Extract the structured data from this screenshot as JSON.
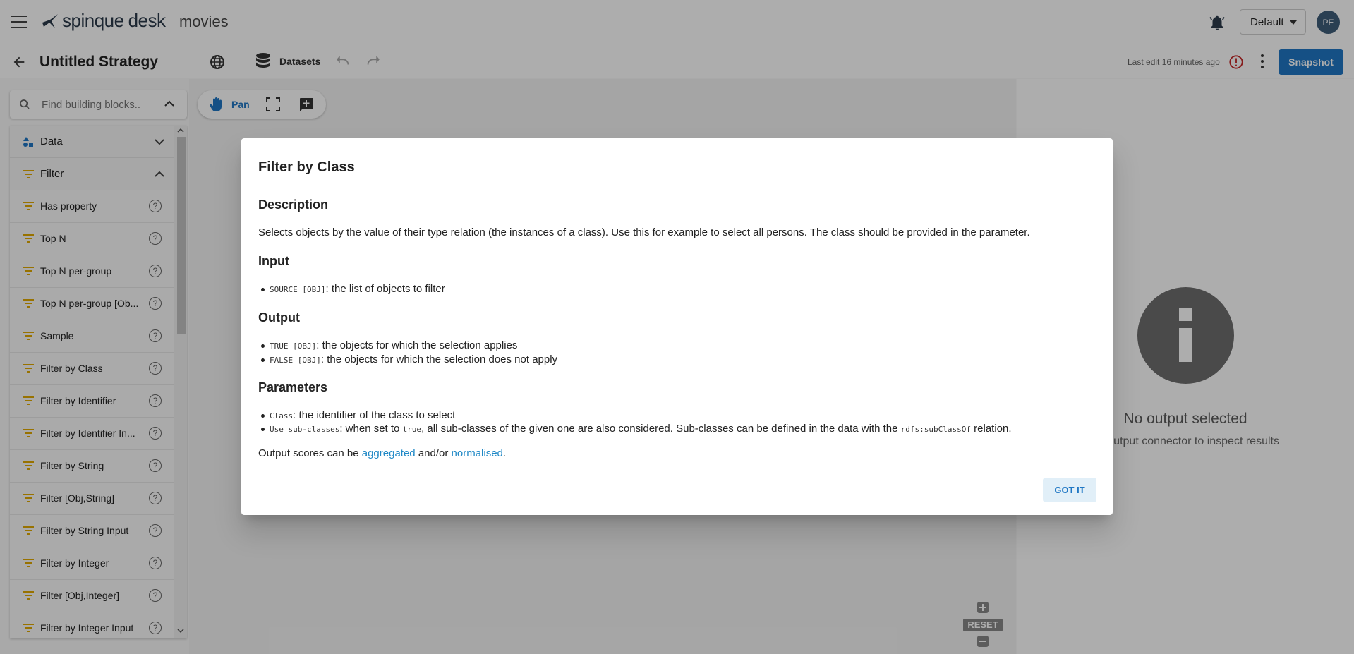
{
  "app": {
    "logo_text": "spinque",
    "logo_suffix": "desk",
    "project": "movies",
    "workspace": "Default",
    "user_initials": "PE"
  },
  "toolbar": {
    "title": "Untitled Strategy",
    "datasets_label": "Datasets",
    "last_edit": "Last edit 16 minutes ago",
    "snapshot_label": "Snapshot"
  },
  "search": {
    "placeholder": "Find building blocks.."
  },
  "categories": [
    {
      "label": "Data"
    },
    {
      "label": "Filter"
    }
  ],
  "blocks": [
    {
      "label": "Has property"
    },
    {
      "label": "Top N"
    },
    {
      "label": "Top N per-group"
    },
    {
      "label": "Top N per-group [Ob..."
    },
    {
      "label": "Sample"
    },
    {
      "label": "Filter by Class"
    },
    {
      "label": "Filter by Identifier"
    },
    {
      "label": "Filter by Identifier In..."
    },
    {
      "label": "Filter by String"
    },
    {
      "label": "Filter [Obj,String]"
    },
    {
      "label": "Filter by String Input"
    },
    {
      "label": "Filter by Integer"
    },
    {
      "label": "Filter [Obj,Integer]"
    },
    {
      "label": "Filter by Integer Input"
    }
  ],
  "help_glyph": "?",
  "canvas": {
    "pan_label": "Pan",
    "reset_label": "RESET"
  },
  "right_panel": {
    "title": "No output selected",
    "subtitle": "an output connector to inspect results"
  },
  "dialog": {
    "title": "Filter by Class",
    "description_heading": "Description",
    "description": "Selects objects by the value of their type relation (the instances of a class). Use this for example to select all persons. The class should be provided in the parameter.",
    "input_heading": "Input",
    "input_code": "SOURCE [OBJ]",
    "input_text": ": the list of objects to filter",
    "output_heading": "Output",
    "output_true_code": "TRUE [OBJ]",
    "output_true_text": ": the objects for which the selection applies",
    "output_false_code": "FALSE [OBJ]",
    "output_false_text": ": the objects for which the selection does not apply",
    "params_heading": "Parameters",
    "param1_code": "Class",
    "param1_text": ": the identifier of the class to select",
    "param2_code": "Use sub-classes",
    "param2_text_a": ": when set to ",
    "param2_code_b": "true",
    "param2_text_b": ", all sub-classes of the given one are also considered. Sub-classes can be defined in the data with the ",
    "param2_code_c": "rdfs:subClassOf",
    "param2_text_c": " relation.",
    "scores_a": "Output scores can be ",
    "scores_link1": "aggregated",
    "scores_b": " and/or ",
    "scores_link2": "normalised",
    "scores_c": ".",
    "gotit_label": "GOT IT"
  }
}
